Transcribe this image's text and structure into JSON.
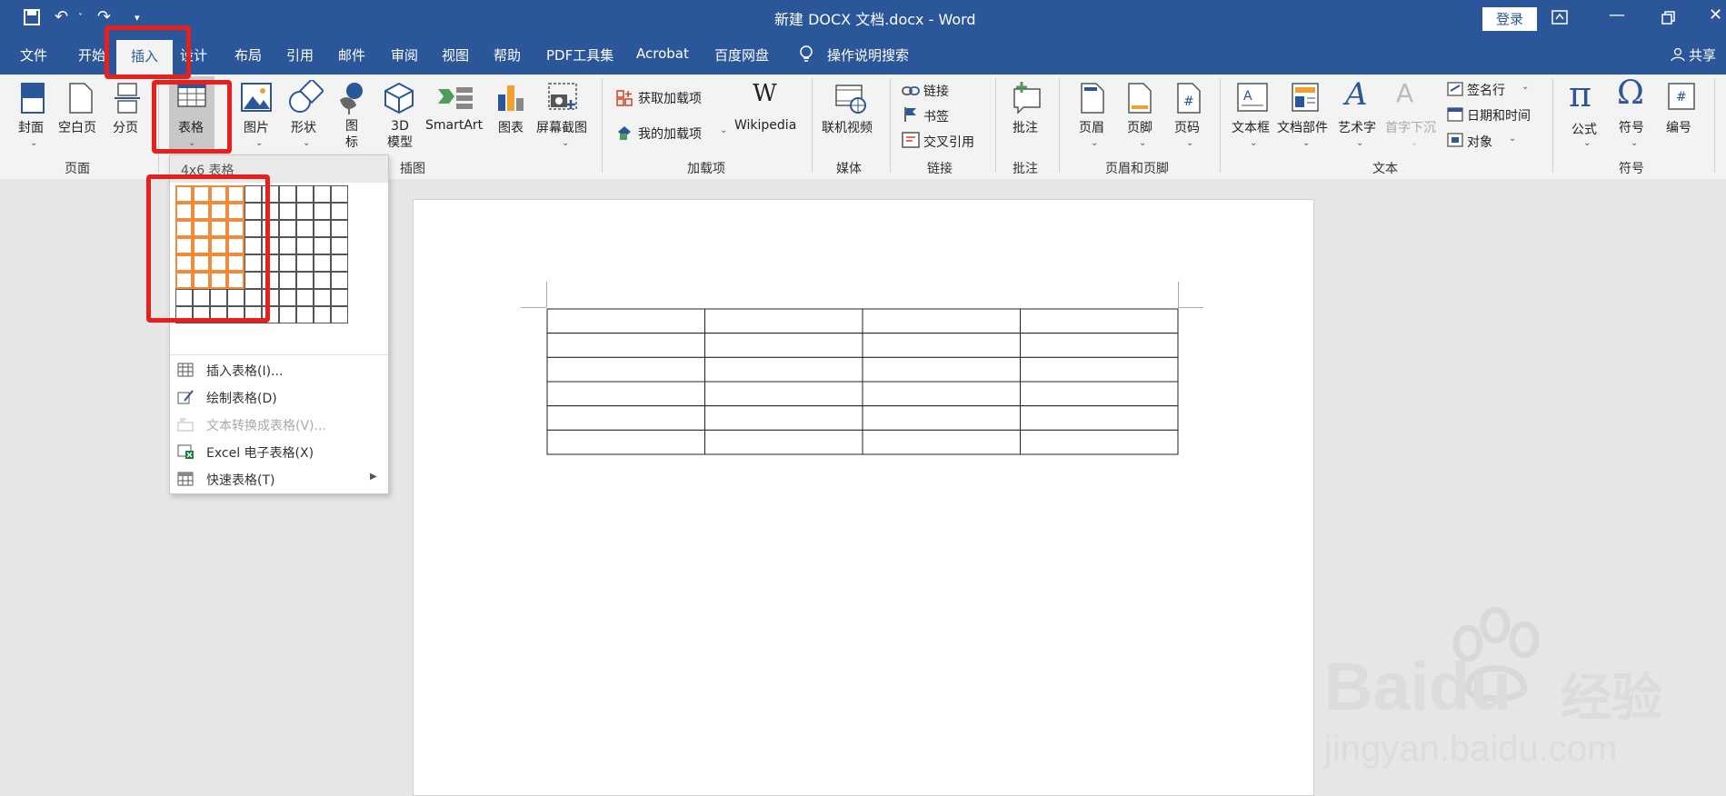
{
  "window": {
    "title": "新建 DOCX 文档.docx - Word",
    "login_label": "登录"
  },
  "tabs": [
    "文件",
    "开始",
    "插入",
    "设计",
    "布局",
    "引用",
    "邮件",
    "审阅",
    "视图",
    "帮助",
    "PDF工具集",
    "Acrobat",
    "百度网盘"
  ],
  "tab_visible_labels": {
    "start": "开始",
    "design": "设计"
  },
  "active_tab": "插入",
  "tell_me": "操作说明搜索",
  "share_label": "共享",
  "ribbon": {
    "pages_group": {
      "label": "页面",
      "cover": "封面",
      "blank_page": "空白页",
      "page_break": "分页"
    },
    "tables_group": {
      "table": "表格"
    },
    "illustrations_group": {
      "label": "插图",
      "pictures": "图片",
      "shapes": "形状",
      "icons": "图\n标",
      "models_3d_line1": "3D",
      "models_3d_line2": "模型",
      "smartart": "SmartArt",
      "chart": "图表",
      "screenshot": "屏幕截图"
    },
    "addins_group": {
      "label": "加载项",
      "get_addins": "获取加载项",
      "my_addins": "我的加载项",
      "wikipedia": "Wikipedia"
    },
    "media_group": {
      "label": "媒体",
      "online_video": "联机视频"
    },
    "links_group": {
      "label": "链接",
      "link": "链接",
      "bookmark": "书签",
      "cross_ref": "交叉引用"
    },
    "comments_group": {
      "label": "批注",
      "comment": "批注"
    },
    "header_footer_group": {
      "label": "页眉和页脚",
      "header": "页眉",
      "footer": "页脚",
      "page_number": "页码"
    },
    "text_group": {
      "label": "文本",
      "textbox": "文本框",
      "quick_parts": "文档部件",
      "wordart": "艺术字",
      "dropcap": "首字下沉",
      "signature": "签名行",
      "datetime": "日期和时间",
      "object": "对象"
    },
    "symbols_group": {
      "label": "符号",
      "equation": "公式",
      "symbol": "符号",
      "number": "编号"
    }
  },
  "table_dropdown": {
    "header": "4x6 表格",
    "grid_cols": 10,
    "grid_rows": 8,
    "selected_cols": 4,
    "selected_rows": 6,
    "menu": [
      {
        "label": "插入表格(I)...",
        "disabled": false
      },
      {
        "label": "绘制表格(D)",
        "disabled": false
      },
      {
        "label": "文本转换成表格(V)...",
        "disabled": true
      },
      {
        "label": "Excel 电子表格(X)",
        "disabled": false
      },
      {
        "label": "快速表格(T)",
        "disabled": false,
        "submenu": true
      }
    ]
  },
  "document_table": {
    "cols": 4,
    "rows": 6
  },
  "watermark": {
    "brand": "Baidu",
    "brand_cn": "经验",
    "url": "jingyan.baidu.com"
  },
  "colors": {
    "word_blue": "#2b579a",
    "highlight_red": "#e8201c",
    "grid_orange": "#f08a3c"
  }
}
